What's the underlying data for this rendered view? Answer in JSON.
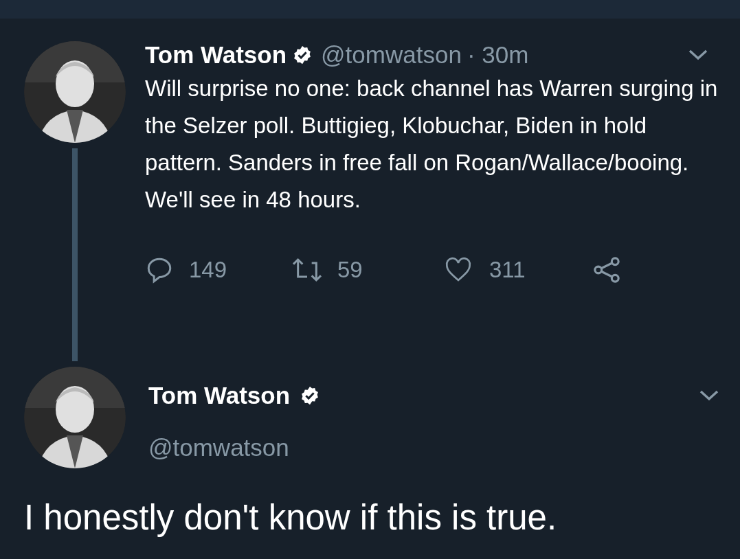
{
  "tweets": [
    {
      "name": "Tom Watson",
      "verified": true,
      "handle": "@tomwatson",
      "time": "· 30m",
      "text": "Will surprise no one: back channel has Warren surging in the Selzer poll. Buttigieg, Klobuchar, Biden in hold pattern. Sanders in free fall on Rogan/Wallace/booing. We'll see in 48 hours.",
      "replies": "149",
      "retweets": "59",
      "likes": "311",
      "thread": true
    },
    {
      "name": "Tom Watson",
      "verified": true,
      "handle": "@tomwatson",
      "text": "I honestly don't know if this is true."
    }
  ]
}
